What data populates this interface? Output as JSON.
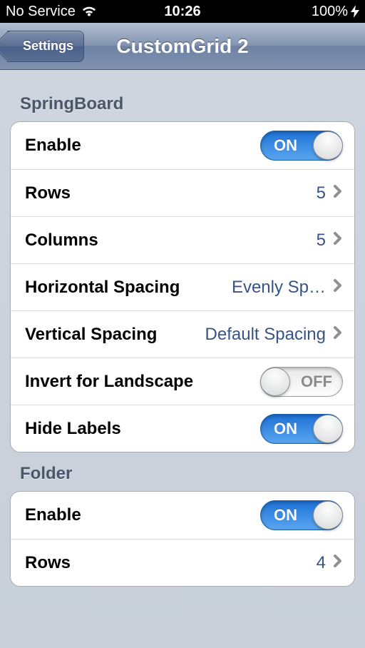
{
  "statusbar": {
    "carrier": "No Service",
    "time": "10:26",
    "battery": "100%"
  },
  "nav": {
    "back": "Settings",
    "title": "CustomGrid 2"
  },
  "toggle_text": {
    "on": "ON",
    "off": "OFF"
  },
  "sections": {
    "springboard": {
      "header": "SpringBoard",
      "enable": {
        "label": "Enable",
        "on": true
      },
      "rows": {
        "label": "Rows",
        "value": "5"
      },
      "columns": {
        "label": "Columns",
        "value": "5"
      },
      "hspacing": {
        "label": "Horizontal Spacing",
        "value": "Evenly Sp…"
      },
      "vspacing": {
        "label": "Vertical Spacing",
        "value": "Default Spacing"
      },
      "invert": {
        "label": "Invert for Landscape",
        "on": false
      },
      "hidelabels": {
        "label": "Hide Labels",
        "on": true
      }
    },
    "folder": {
      "header": "Folder",
      "enable": {
        "label": "Enable",
        "on": true
      },
      "rows": {
        "label": "Rows",
        "value": "4"
      }
    }
  }
}
